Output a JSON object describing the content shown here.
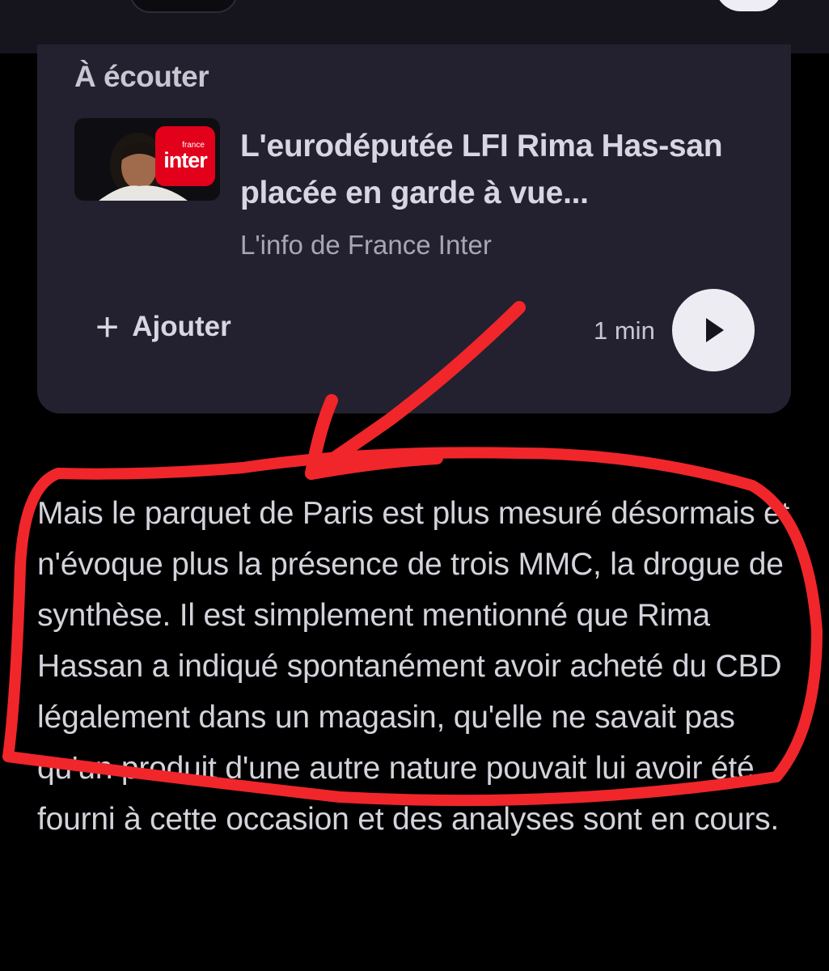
{
  "card": {
    "section_title": "À écouter",
    "episode_title": "L'eurodéputée LFI Rima Has-san placée en garde à vue...",
    "source": "L'info de France Inter",
    "logo_small": "france",
    "logo_big": "inter",
    "add_label": "Ajouter",
    "add_icon": "plus-icon",
    "duration": "1 min",
    "play_icon": "play-icon"
  },
  "article": {
    "paragraph": "Mais le parquet de Paris est plus mesuré désormais et n'évoque plus la présence de trois MMC, la drogue de synthèse. Il est simplement mentionné que Rima Hassan a indiqué spontanément avoir acheté du CBD légalement dans un magasin, qu'elle ne savait pas qu'un produit d'une autre nature pouvait lui avoir été fourni à cette occasion et des analyses sont en cours."
  },
  "annotation": {
    "color": "#f0262b"
  }
}
